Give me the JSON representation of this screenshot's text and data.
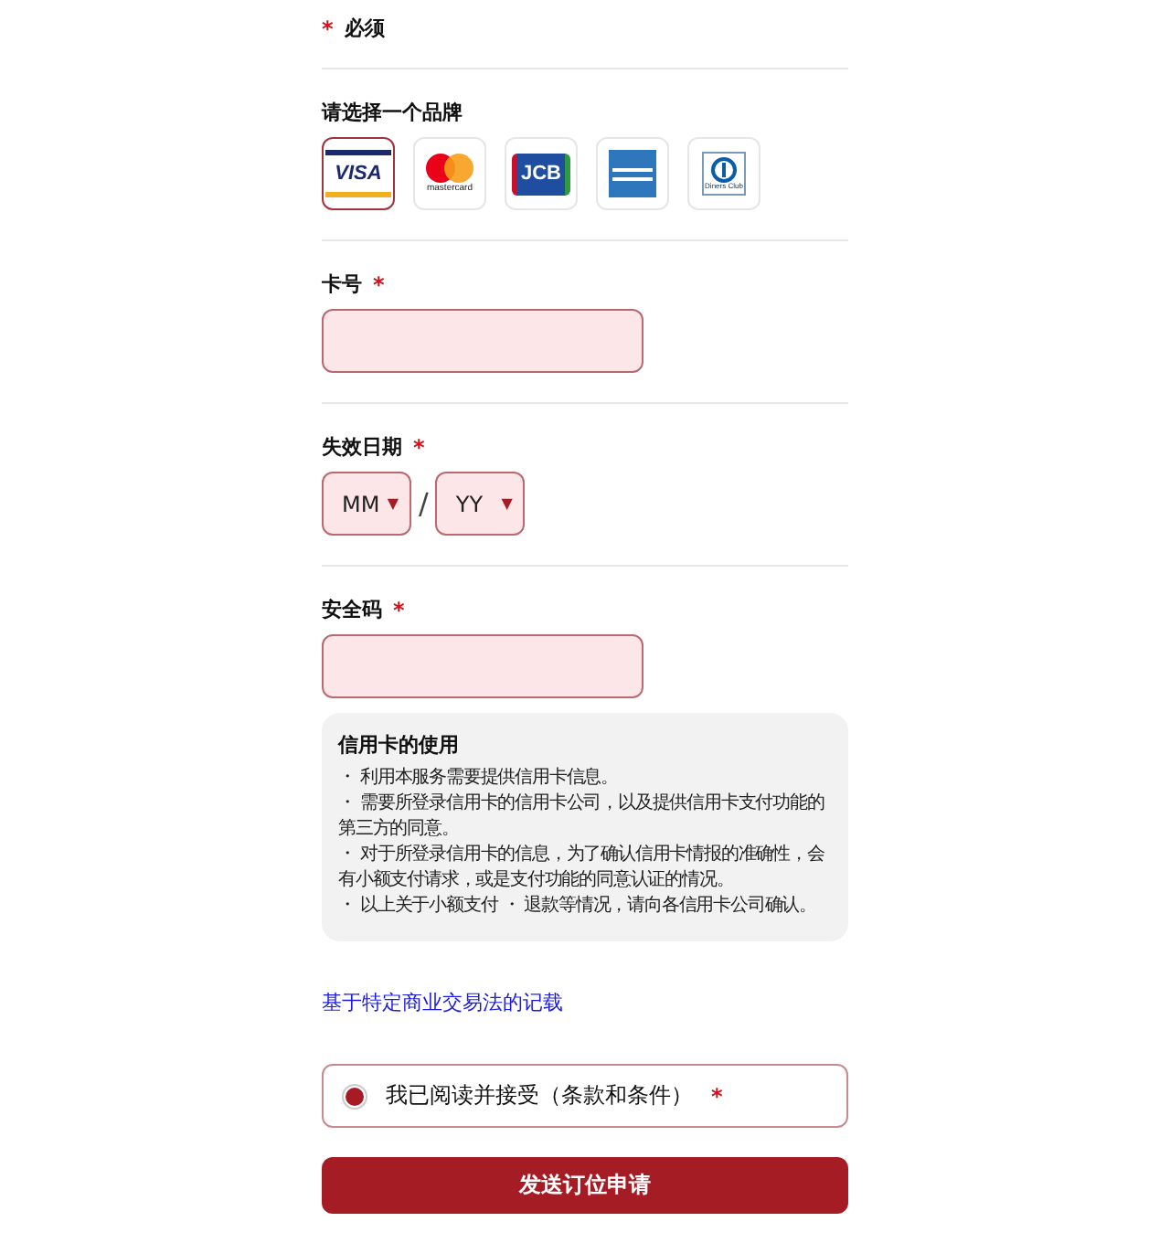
{
  "required_note": {
    "mark": "*",
    "label": "必须"
  },
  "brand_picker": {
    "label": "请选择一个品牌",
    "brands": [
      {
        "kind": "visa",
        "label": "VISA",
        "selected": true
      },
      {
        "kind": "mastercard",
        "label": "mastercard",
        "selected": false
      },
      {
        "kind": "jcb",
        "label": "JCB",
        "selected": false
      },
      {
        "kind": "amex",
        "selected": false
      },
      {
        "kind": "diners",
        "label": "Diners Club",
        "selected": false
      }
    ]
  },
  "fields": [
    {
      "kind": "text",
      "label": "卡号",
      "mark": "*"
    },
    {
      "kind": "expiry",
      "label": "失效日期",
      "mark": "*",
      "month": "MM",
      "separator": "/",
      "year": "YY",
      "caret": "▼"
    },
    {
      "kind": "text",
      "label": "安全码",
      "mark": "*"
    }
  ],
  "info_box": {
    "title": "信用卡的使用",
    "lines": [
      "・ 利用本服务需要提供信用卡信息。",
      "・ 需要所登录信用卡的信用卡公司，以及提供信用卡支付功能的第三方的同意。",
      "・ 对于所登录信用卡的信息，为了确认信用卡情报的准确性，会有小额支付请求，或是支付功能的同意认证的情况。",
      "・ 以上关于小额支付 ・ 退款等情况，请向各信用卡公司确认。"
    ]
  },
  "law_link": "基于特定商业交易法的记载",
  "agreement": {
    "label": "我已阅读并接受（条款和条件）",
    "mark": "*",
    "checked": true
  },
  "submit_button": "发送订位申请"
}
